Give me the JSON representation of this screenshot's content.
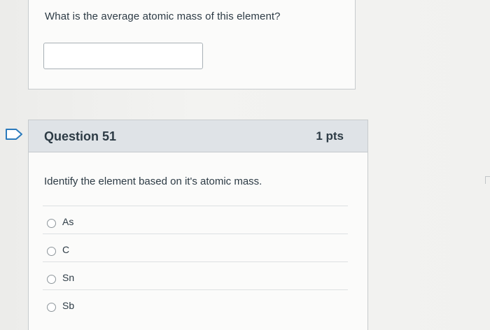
{
  "previous_question": {
    "text": "What is the average atomic mass of this element?",
    "answer_value": "",
    "answer_placeholder": ""
  },
  "question": {
    "title": "Question 51",
    "points": "1 pts",
    "prompt": "Identify the element based on it's atomic mass.",
    "choices": [
      {
        "label": "As",
        "selected": false
      },
      {
        "label": "C",
        "selected": false
      },
      {
        "label": "Sn",
        "selected": false
      },
      {
        "label": "Sb",
        "selected": false
      }
    ]
  },
  "icons": {
    "flag": "bookmark-flag-icon",
    "radio": "radio-unselected-icon"
  },
  "colors": {
    "header_bg": "#dfe3e7",
    "text": "#2d3b45",
    "flag_accent": "#2b7abc"
  }
}
